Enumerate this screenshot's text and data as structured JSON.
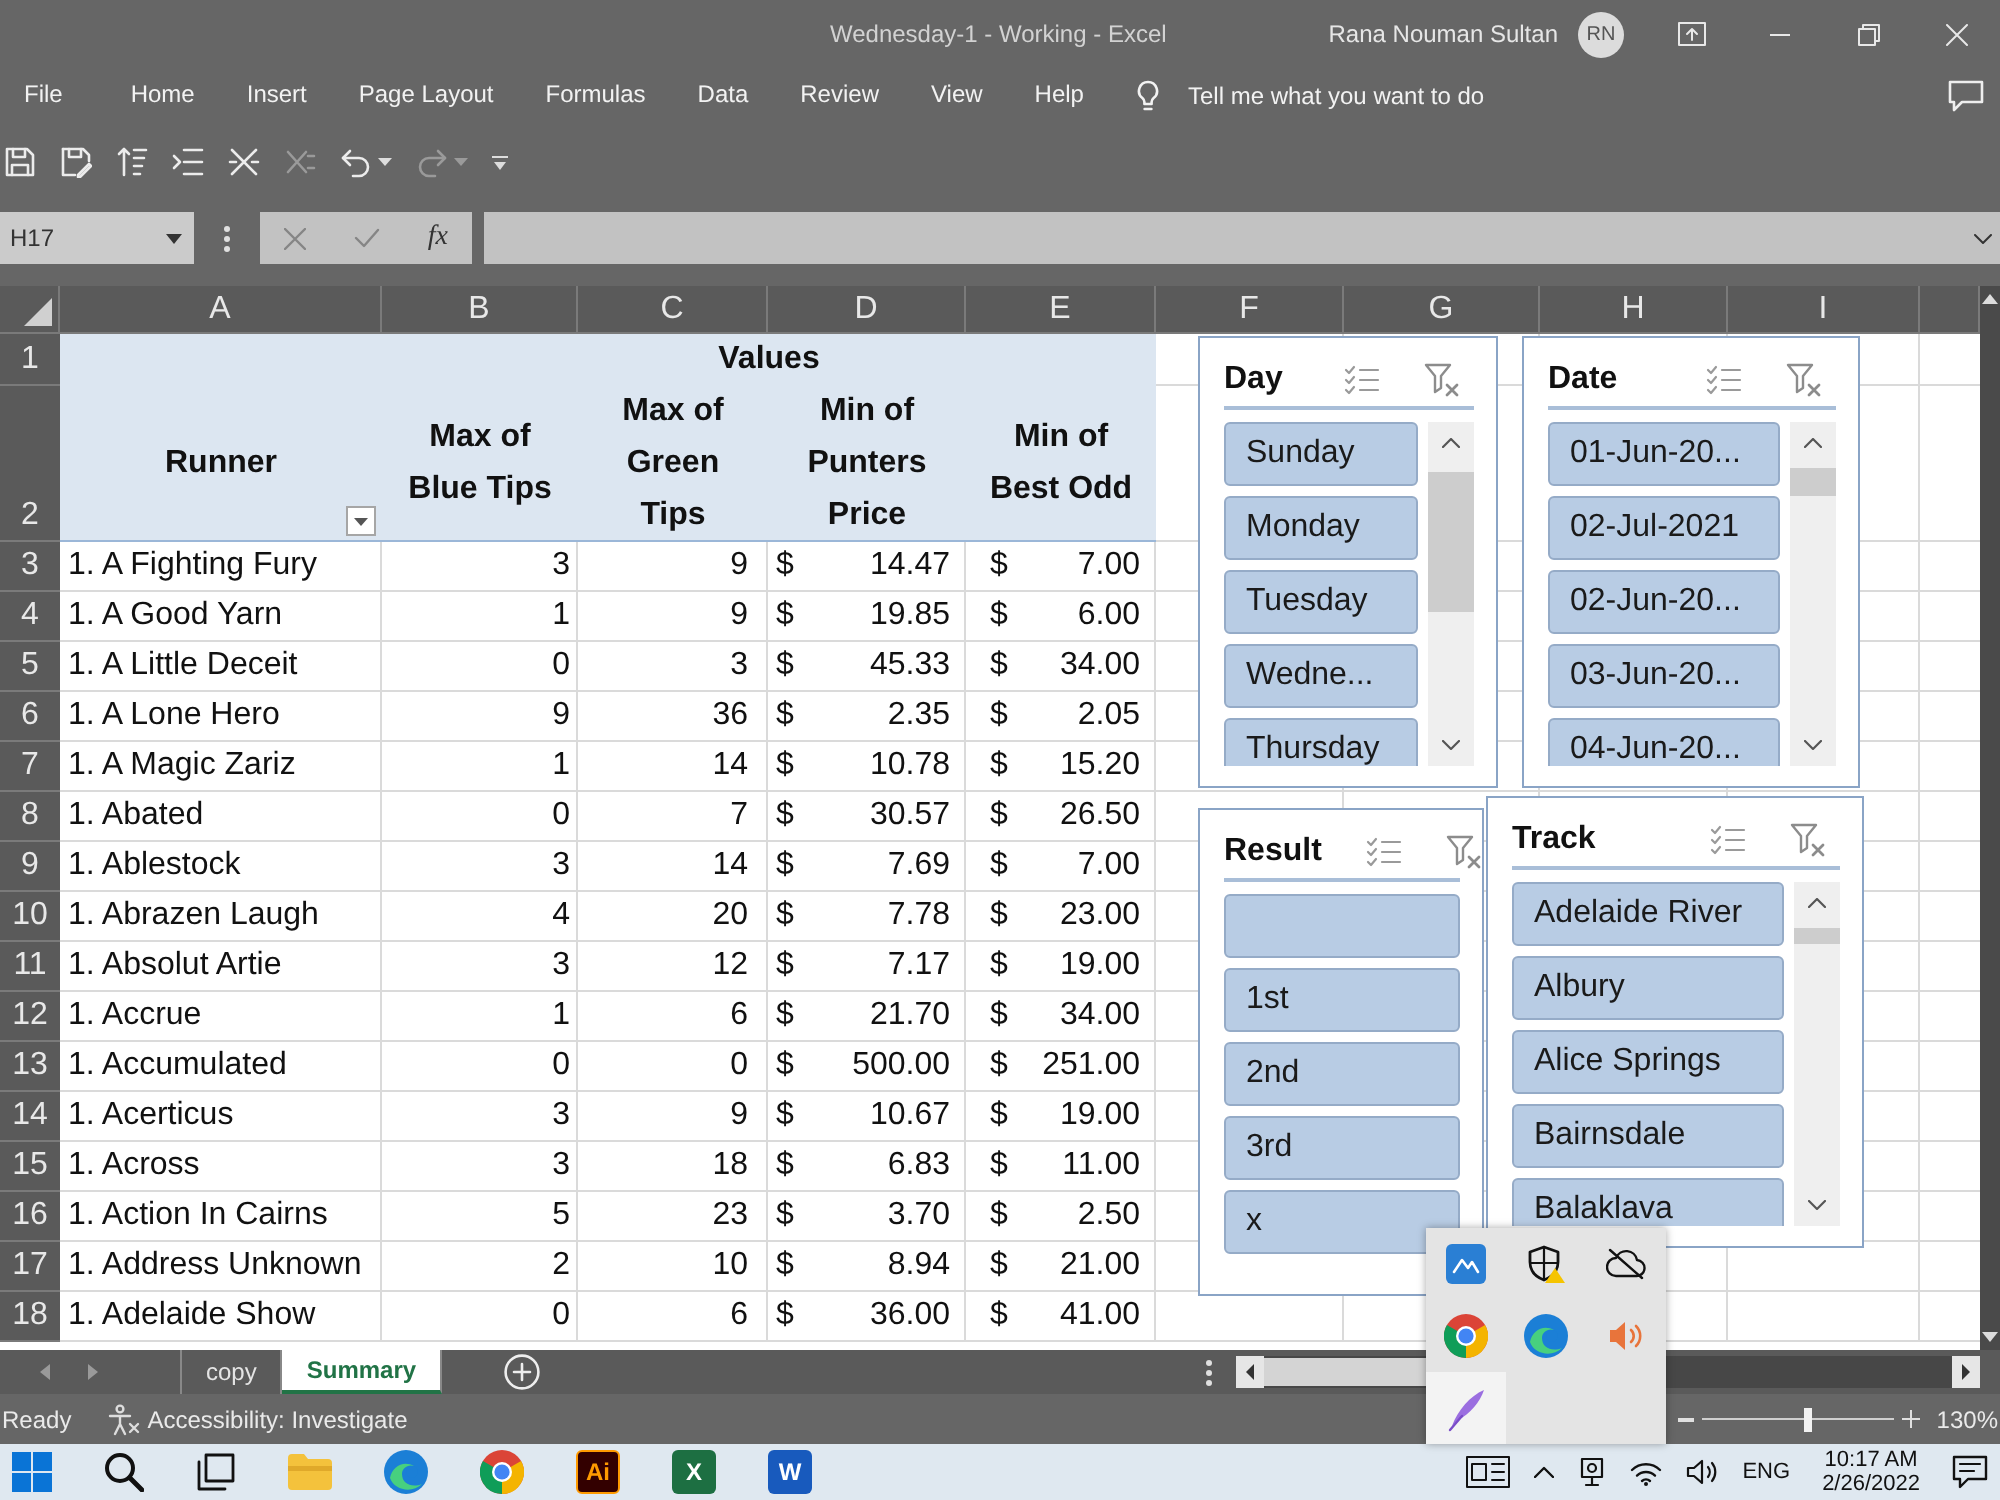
{
  "window": {
    "title": "Wednesday-1 - Working - Excel",
    "user_name": "Rana Nouman Sultan",
    "user_initials": "RN"
  },
  "ribbon_tabs": [
    {
      "label": "File",
      "selected": false
    },
    {
      "label": "Home",
      "selected": false
    },
    {
      "label": "Insert",
      "selected": false
    },
    {
      "label": "Page Layout",
      "selected": false
    },
    {
      "label": "Formulas",
      "selected": false
    },
    {
      "label": "Data",
      "selected": false
    },
    {
      "label": "Review",
      "selected": false
    },
    {
      "label": "View",
      "selected": false
    },
    {
      "label": "Help",
      "selected": false
    }
  ],
  "tell_me": {
    "label": "Tell me what you want to do"
  },
  "formula_bar": {
    "name_box": "H17",
    "function_label": "fx"
  },
  "sheet": {
    "column_headers": [
      "A",
      "B",
      "C",
      "D",
      "E",
      "F",
      "G",
      "H",
      "I"
    ],
    "row_headers": [
      "1",
      "2",
      "3",
      "4",
      "5",
      "6",
      "7",
      "8",
      "9",
      "10",
      "11",
      "12",
      "13",
      "14",
      "15",
      "16",
      "17",
      "18"
    ],
    "pivot": {
      "values_caption": "Values",
      "headers": [
        {
          "label": "Runner",
          "filter": true
        },
        {
          "label": "Max of\nBlue Tips",
          "filter": false
        },
        {
          "label": "Max of\nGreen\nTips",
          "filter": false
        },
        {
          "label": "Min of\nPunters\nPrice",
          "filter": false
        },
        {
          "label": "Min of\nBest Odd",
          "filter": false
        }
      ],
      "rows": [
        {
          "runner": "1. A Fighting Fury",
          "blue_tips": "3",
          "green_tips": "9",
          "punters_price": {
            "symbol": "$",
            "amount": "14.47"
          },
          "best_odd": {
            "symbol": "$",
            "amount": "7.00"
          }
        },
        {
          "runner": "1. A Good Yarn",
          "blue_tips": "1",
          "green_tips": "9",
          "punters_price": {
            "symbol": "$",
            "amount": "19.85"
          },
          "best_odd": {
            "symbol": "$",
            "amount": "6.00"
          }
        },
        {
          "runner": "1. A Little Deceit",
          "blue_tips": "0",
          "green_tips": "3",
          "punters_price": {
            "symbol": "$",
            "amount": "45.33"
          },
          "best_odd": {
            "symbol": "$",
            "amount": "34.00"
          }
        },
        {
          "runner": "1. A Lone Hero",
          "blue_tips": "9",
          "green_tips": "36",
          "punters_price": {
            "symbol": "$",
            "amount": "2.35"
          },
          "best_odd": {
            "symbol": "$",
            "amount": "2.05"
          }
        },
        {
          "runner": "1. A Magic Zariz",
          "blue_tips": "1",
          "green_tips": "14",
          "punters_price": {
            "symbol": "$",
            "amount": "10.78"
          },
          "best_odd": {
            "symbol": "$",
            "amount": "15.20"
          }
        },
        {
          "runner": "1. Abated",
          "blue_tips": "0",
          "green_tips": "7",
          "punters_price": {
            "symbol": "$",
            "amount": "30.57"
          },
          "best_odd": {
            "symbol": "$",
            "amount": "26.50"
          }
        },
        {
          "runner": "1. Ablestock",
          "blue_tips": "3",
          "green_tips": "14",
          "punters_price": {
            "symbol": "$",
            "amount": "7.69"
          },
          "best_odd": {
            "symbol": "$",
            "amount": "7.00"
          }
        },
        {
          "runner": "1. Abrazen Laugh",
          "blue_tips": "4",
          "green_tips": "20",
          "punters_price": {
            "symbol": "$",
            "amount": "7.78"
          },
          "best_odd": {
            "symbol": "$",
            "amount": "23.00"
          }
        },
        {
          "runner": "1. Absolut Artie",
          "blue_tips": "3",
          "green_tips": "12",
          "punters_price": {
            "symbol": "$",
            "amount": "7.17"
          },
          "best_odd": {
            "symbol": "$",
            "amount": "19.00"
          }
        },
        {
          "runner": "1. Accrue",
          "blue_tips": "1",
          "green_tips": "6",
          "punters_price": {
            "symbol": "$",
            "amount": "21.70"
          },
          "best_odd": {
            "symbol": "$",
            "amount": "34.00"
          }
        },
        {
          "runner": "1. Accumulated",
          "blue_tips": "0",
          "green_tips": "0",
          "punters_price": {
            "symbol": "$",
            "amount": "500.00"
          },
          "best_odd": {
            "symbol": "$",
            "amount": "251.00"
          }
        },
        {
          "runner": "1. Acerticus",
          "blue_tips": "3",
          "green_tips": "9",
          "punters_price": {
            "symbol": "$",
            "amount": "10.67"
          },
          "best_odd": {
            "symbol": "$",
            "amount": "19.00"
          }
        },
        {
          "runner": "1. Across",
          "blue_tips": "3",
          "green_tips": "18",
          "punters_price": {
            "symbol": "$",
            "amount": "6.83"
          },
          "best_odd": {
            "symbol": "$",
            "amount": "11.00"
          }
        },
        {
          "runner": "1. Action In Cairns",
          "blue_tips": "5",
          "green_tips": "23",
          "punters_price": {
            "symbol": "$",
            "amount": "3.70"
          },
          "best_odd": {
            "symbol": "$",
            "amount": "2.50"
          }
        },
        {
          "runner": "1. Address Unknown",
          "blue_tips": "2",
          "green_tips": "10",
          "punters_price": {
            "symbol": "$",
            "amount": "8.94"
          },
          "best_odd": {
            "symbol": "$",
            "amount": "21.00"
          }
        },
        {
          "runner": "1. Adelaide Show",
          "blue_tips": "0",
          "green_tips": "6",
          "punters_price": {
            "symbol": "$",
            "amount": "36.00"
          },
          "best_odd": {
            "symbol": "$",
            "amount": "41.00"
          }
        }
      ]
    }
  },
  "slicers": [
    {
      "title": "Day",
      "scrollable": true,
      "items": [
        {
          "label": "Sunday",
          "selected": true
        },
        {
          "label": "Monday",
          "selected": true
        },
        {
          "label": "Tuesday",
          "selected": true
        },
        {
          "label": "Wedne...",
          "selected": true
        },
        {
          "label": "Thursday",
          "selected": true
        }
      ]
    },
    {
      "title": "Date",
      "scrollable": true,
      "items": [
        {
          "label": "01-Jun-20...",
          "selected": true
        },
        {
          "label": "02-Jul-2021",
          "selected": true
        },
        {
          "label": "02-Jun-20...",
          "selected": true
        },
        {
          "label": "03-Jun-20...",
          "selected": true
        },
        {
          "label": "04-Jun-20...",
          "selected": true
        }
      ]
    },
    {
      "title": "Result",
      "scrollable": false,
      "items": [
        {
          "selected": true
        },
        {
          "label": "1st",
          "selected": true
        },
        {
          "label": "2nd",
          "selected": true
        },
        {
          "label": "3rd",
          "selected": true
        },
        {
          "label": "x",
          "selected": true
        }
      ]
    },
    {
      "title": "Track",
      "scrollable": true,
      "items": [
        {
          "label": "Adelaide River",
          "selected": true
        },
        {
          "label": "Albury",
          "selected": true
        },
        {
          "label": "Alice Springs",
          "selected": true
        },
        {
          "label": "Bairnsdale",
          "selected": true
        },
        {
          "label": "Balaklava",
          "selected": true
        }
      ]
    }
  ],
  "sheet_tabs": [
    {
      "label": "copy",
      "selected": false
    },
    {
      "label": "Summary",
      "selected": true
    }
  ],
  "status_bar": {
    "status": "Ready",
    "accessibility": "Accessibility: Investigate",
    "zoom": {
      "level": 0.55,
      "reading": "130%"
    }
  },
  "taskbar": {
    "pinned": [
      {
        "kind": "design",
        "letters": "Ai"
      },
      {
        "kind": "spreadsheet",
        "letters": "X"
      },
      {
        "kind": "document",
        "letters": "W"
      }
    ],
    "language": "ENG",
    "time": "10:17 AM",
    "date": "2/26/2022"
  }
}
